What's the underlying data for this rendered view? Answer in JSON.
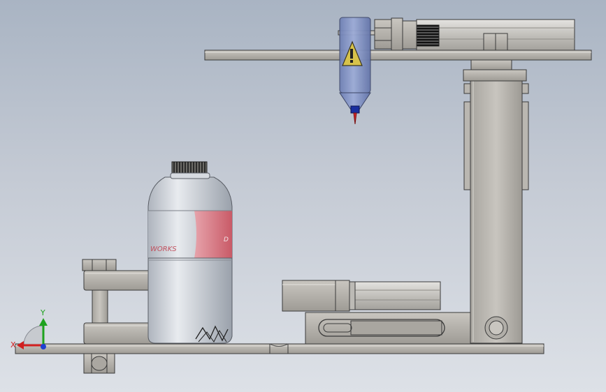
{
  "viewport": {
    "background_top": "#a9b4c3",
    "background_bottom": "#dde1e7"
  },
  "model": {
    "part_color": "#b6b3ad",
    "edge_color": "#3a3a3a",
    "bottle_color": "#cdd2d9",
    "bottle_label_color": "#d96c78",
    "syringe_color": "#7f8fc0",
    "needle_tip_color": "#d1262a",
    "bottle_label_text": "WORKS",
    "bottle_label_text_2": "D"
  },
  "triad": {
    "x_label": "X",
    "y_label": "Y",
    "x_color": "#d12020",
    "y_color": "#1ea21e",
    "z_color": "#2040d0"
  }
}
